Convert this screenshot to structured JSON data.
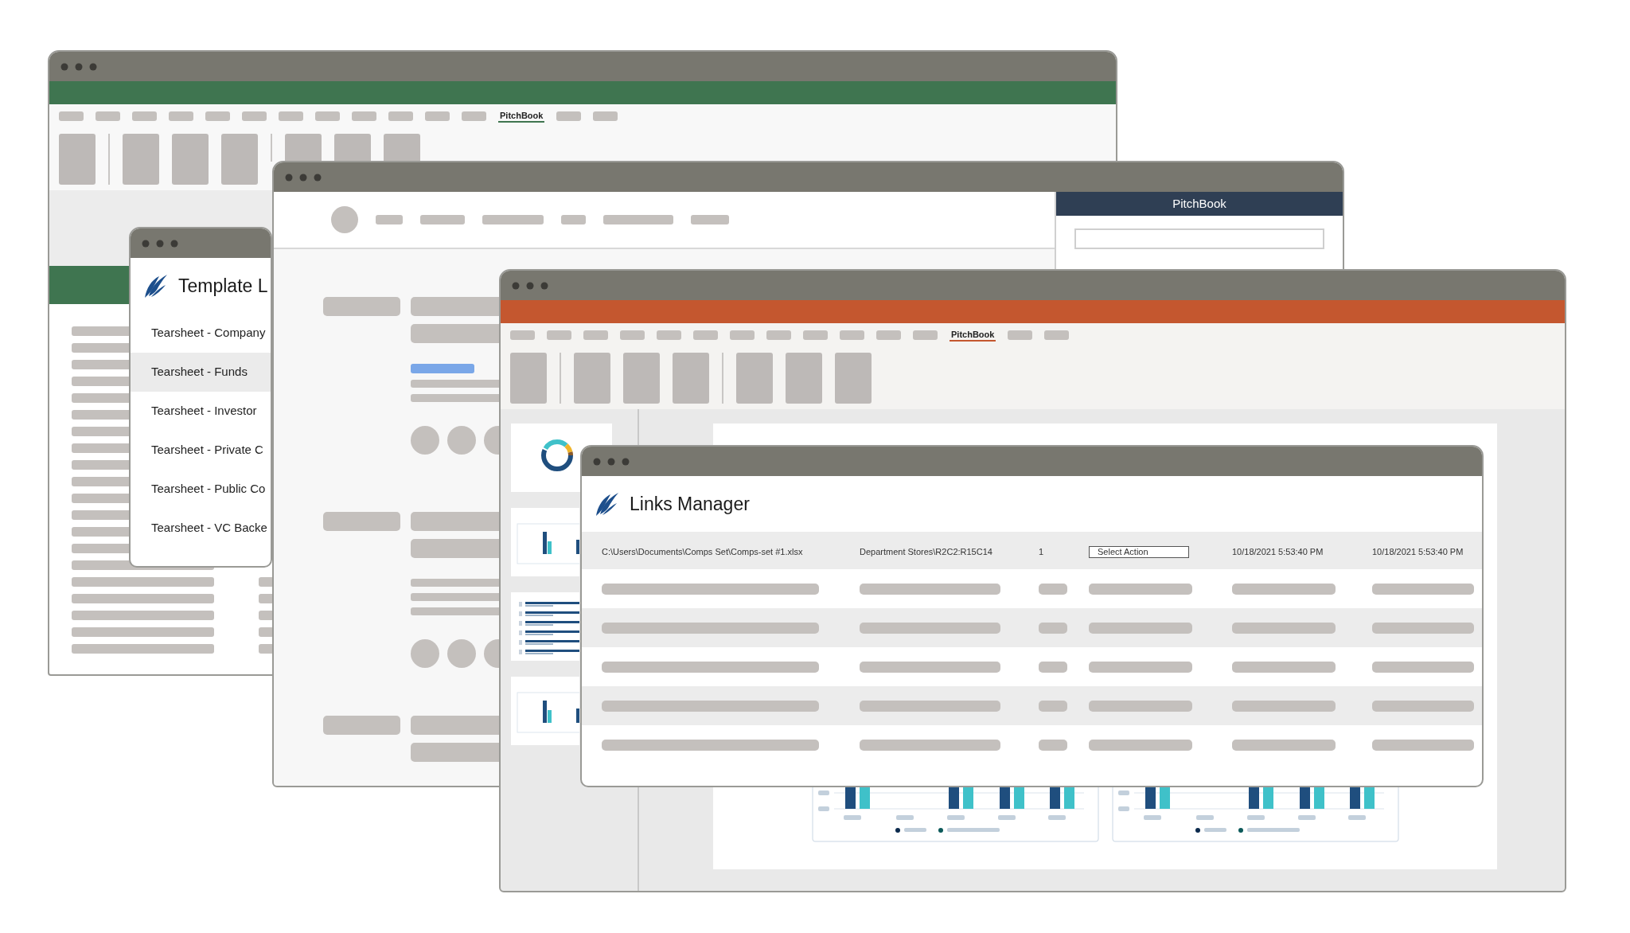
{
  "excel_window": {
    "ribbon_tab": "PitchBook"
  },
  "template_window": {
    "title": "Template L",
    "items": [
      {
        "label": "Tearsheet - Company",
        "selected": false
      },
      {
        "label": "Tearsheet - Funds",
        "selected": true
      },
      {
        "label": "Tearsheet - Investor",
        "selected": false
      },
      {
        "label": "Tearsheet - Private C",
        "selected": false
      },
      {
        "label": "Tearsheet - Public Co",
        "selected": false
      },
      {
        "label": "Tearsheet - VC Backe",
        "selected": false
      }
    ]
  },
  "middle_window": {
    "side_panel": {
      "title": "PitchBook"
    }
  },
  "powerpoint_window": {
    "ribbon_tab": "PitchBook"
  },
  "links_manager": {
    "title": "Links Manager",
    "row": {
      "path": "C:\\Users\\Documents\\Comps Set\\Comps-set #1.xlsx",
      "range": "Department Stores\\R2C2:R15C14",
      "count": "1",
      "action": "Select Action",
      "created": "10/18/2021 5:53:40 PM",
      "updated": "10/18/2021 5:53:40 PM"
    }
  }
}
